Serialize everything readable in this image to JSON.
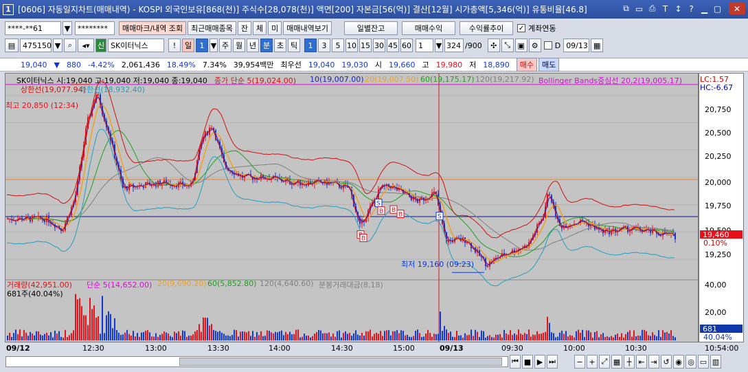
{
  "window": {
    "num": "1",
    "title": "[0606] 자동일지차트(매매내역) - KOSPI 외국인보유[868(천)] 주식수[28,078(천)] 액면[200] 자본금[56(억)] 결산[12월] 시가총액[5,346(억)] 유통비율[46.8]"
  },
  "toolbar1": {
    "account": "****-**61",
    "password": "********",
    "btn_mark": "매매마크/내역 조회",
    "btn_recent": "최근매매종목",
    "btn_jan": "잔",
    "btn_che": "체",
    "btn_mi": "미",
    "btn_history": "매매내역보기",
    "btn_daily": "일별잔고",
    "btn_profit": "매매수익",
    "btn_trend": "수익률추이",
    "link_label": "계좌연동"
  },
  "toolbar2": {
    "code": "475150",
    "name": "SK이터닉스",
    "shin": "신",
    "excl": "!",
    "period_sel": "일",
    "period_num": "1",
    "periods": [
      "주",
      "월",
      "년"
    ],
    "unit_sel": "분",
    "unit_other": "초",
    "tick": "틱",
    "minutes": [
      "1",
      "3",
      "5",
      "10",
      "15",
      "30",
      "45",
      "60"
    ],
    "count": "1",
    "bars": "324",
    "max_bars": "/900",
    "date": "09/13"
  },
  "quote": {
    "price": "19,040",
    "arrow": "▼",
    "change": "880",
    "pct": "-4.42%",
    "volume": "2,061,436",
    "r1": "18.49%",
    "r2": "7.34%",
    "amount": "39,954백만",
    "best_label": "최우선",
    "best1": "19,040",
    "best2": "19,030",
    "open_label": "시",
    "open": "19,660",
    "high_label": "고",
    "high": "19,980",
    "low_label": "저",
    "low": "18,890",
    "buy": "매수",
    "sell": "매도"
  },
  "legend": {
    "title": "SK이터닉스 시:19,040 고:19,040 저:19,040 종:19,040",
    "ma5": "종가 단순 5(19,024.00)",
    "ma10": "10(19,007.00)",
    "ma20": "20(19,007.50)",
    "ma60": "60(19,175.17)",
    "ma120": "120(19,217.92)",
    "bb": "Bollinger Bands중심선 20,2(19,005.17)",
    "upper": "상한선(19,077.94)",
    "lower": "하한선(18,932.40)",
    "lc": "LC:1.57",
    "hc": "HC:-6.67",
    "vol": "거래량(42,951.00)",
    "v5": "단순 5(14,652.00)",
    "v20": "20(9,690.20)",
    "v60": "60(5,852.80)",
    "v120": "120(4,640.60)",
    "vamt": "분봉거래대금(8,18)",
    "vshares": "681주(40.04%)"
  },
  "annot": {
    "high": "최고 20,850 (12:34)",
    "low": "최저 19,160 (09:23)",
    "b": "B",
    "s": "S"
  },
  "yaxis": [
    "20,750",
    "20,500",
    "20,250",
    "20,000",
    "19,750",
    "19,500",
    "19,250"
  ],
  "price_tag": "19,460",
  "price_pct": "0.10%",
  "vaxis": [
    "40,00",
    "20,00"
  ],
  "vol_tag": "681",
  "vol_pct": "40.04%",
  "xaxis": [
    "09/12",
    "12:30",
    "13:00",
    "13:30",
    "14:00",
    "14:30",
    "15:00",
    "09/13",
    "09:30",
    "10:00",
    "10:30"
  ],
  "time": "10:54:00",
  "colors": {
    "up": "#e8101a",
    "down": "#1038d8",
    "ma5": "#e01010",
    "ma10": "#2020c0",
    "ma20": "#f0a020",
    "ma60": "#20a020",
    "ma120": "#808080",
    "bb": "#d010d0",
    "upper": "#d01010",
    "lower": "#20a0c0"
  },
  "chart_data": {
    "type": "candlestick",
    "ylim": [
      19080,
      20950
    ],
    "high": 20850,
    "low": 19160,
    "last": 19460
  }
}
